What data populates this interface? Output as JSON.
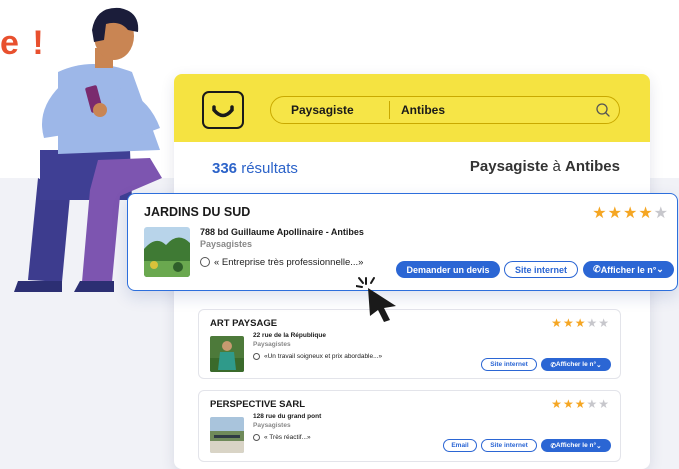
{
  "headline_fragment": "e !",
  "app": {
    "search": {
      "what": "Paysagiste",
      "where": "Antibes"
    }
  },
  "results": {
    "count": "336",
    "count_suffix": "résultats",
    "title_what": "Paysagiste",
    "title_connector": "à",
    "title_where": "Antibes"
  },
  "featured": {
    "name": "JARDINS DU SUD",
    "rating": 4,
    "address": "788 bd Guillaume Apollinaire - Antibes",
    "category": "Paysagistes",
    "quote": "« Entreprise très professionnelle...»",
    "buttons": {
      "quote": "Demander un devis",
      "site": "Site internet",
      "phone": "Afficher le n°"
    }
  },
  "listings": [
    {
      "name": "ART PAYSAGE",
      "rating": 3,
      "address": "22 rue de la République",
      "category": "Paysagistes",
      "quote": "«Un travail soigneux et prix abordable...»",
      "buttons": {
        "site": "Site internet",
        "phone": "Afficher le n°"
      }
    },
    {
      "name": "PERSPECTIVE SARL",
      "rating": 3,
      "address": "128 rue du grand pont",
      "category": "Paysagistes",
      "quote": "« Très réactif...»",
      "buttons": {
        "email": "Email",
        "site": "Site internet",
        "phone": "Afficher le n°"
      }
    }
  ],
  "colors": {
    "header_yellow": "#f5e341",
    "accent_blue": "#2b66d4",
    "headline_orange": "#e8502e",
    "star": "#f5a623"
  }
}
